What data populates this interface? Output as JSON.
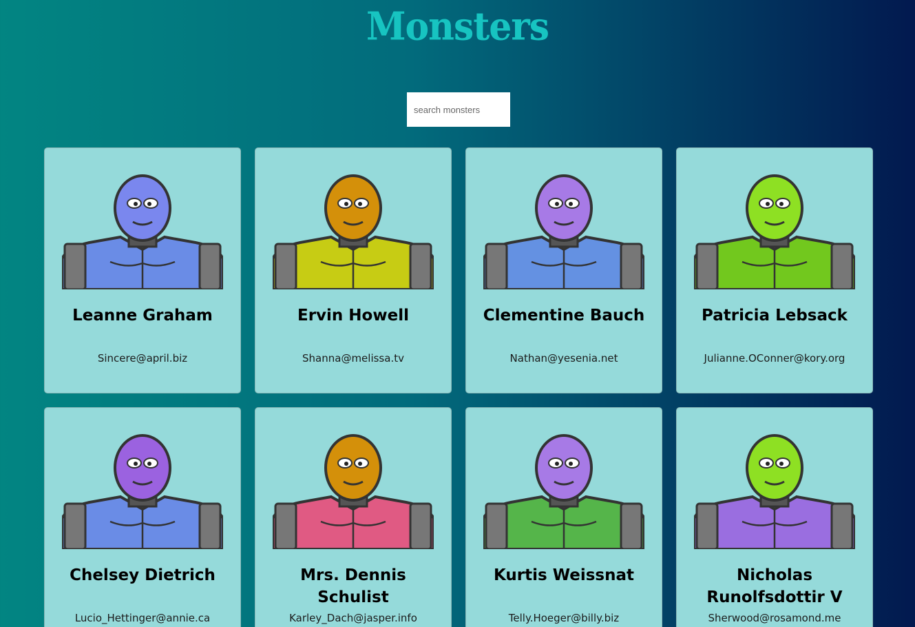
{
  "app": {
    "title": "Monsters"
  },
  "search": {
    "placeholder": "search monsters",
    "value": ""
  },
  "colors": {
    "card_background": "#95dada",
    "title": "#17c4c1",
    "gradient_left": "#028582",
    "gradient_right": "#02194f"
  },
  "monsters": [
    {
      "name": "Leanne Graham",
      "email": "Sincere@april.biz",
      "skin": "#7a87ee",
      "body": "#6a8ce6",
      "icon": "blue-horned-monster-icon"
    },
    {
      "name": "Ervin Howell",
      "email": "Shanna@melissa.tv",
      "skin": "#d4900a",
      "body": "#c7cc14",
      "icon": "orange-spiky-monster-icon"
    },
    {
      "name": "Clementine Bauch",
      "email": "Nathan@yesenia.net",
      "skin": "#a77ae6",
      "body": "#6491e2",
      "icon": "purple-cyclops-robot-monster-icon"
    },
    {
      "name": "Patricia Lebsack",
      "email": "Julianne.OConner@kory.org",
      "skin": "#8ee023",
      "body": "#72c81e",
      "icon": "green-helmet-monster-icon"
    },
    {
      "name": "Chelsey Dietrich",
      "email": "Lucio_Hettinger@annie.ca",
      "skin": "#9b62e0",
      "body": "#6a8ce6",
      "icon": "purple-visor-monster-icon"
    },
    {
      "name": "Mrs. Dennis Schulist",
      "email": "Karley_Dach@jasper.info",
      "skin": "#d4900a",
      "body": "#e05a83",
      "icon": "orange-antenna-monster-icon"
    },
    {
      "name": "Kurtis Weissnat",
      "email": "Telly.Hoeger@billy.biz",
      "skin": "#a77ae6",
      "body": "#55b54a",
      "icon": "purple-unicorn-monster-icon"
    },
    {
      "name": "Nicholas Runolfsdottir V",
      "email": "Sherwood@rosamond.me",
      "skin": "#8ee023",
      "body": "#9a6ee0",
      "icon": "green-robot-monster-icon"
    }
  ]
}
